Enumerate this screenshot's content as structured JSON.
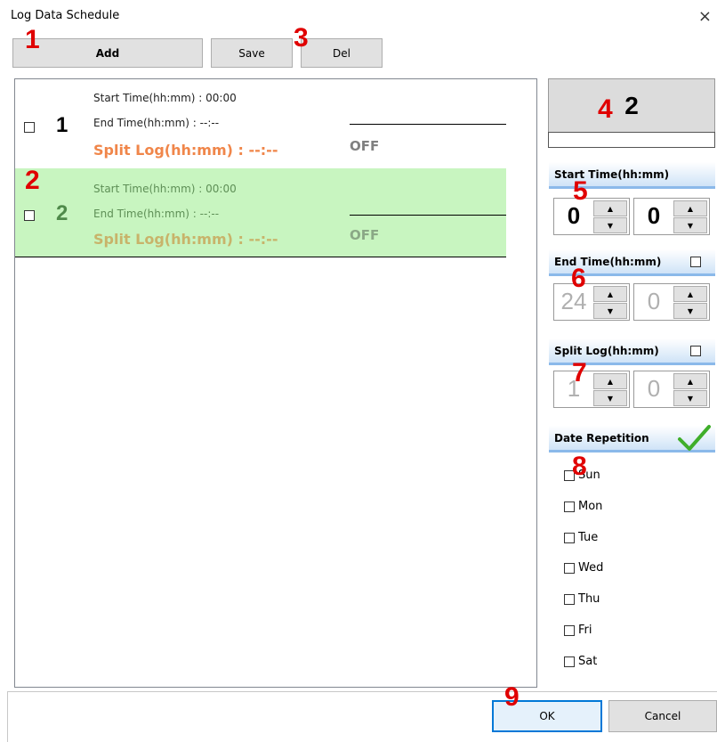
{
  "window": {
    "title": "Log Data Schedule",
    "close_glyph": "×"
  },
  "toolbar": {
    "add_label": "Add",
    "save_label": "Save",
    "del_label": "Del"
  },
  "markers": [
    "1",
    "2",
    "3",
    "4",
    "5",
    "6",
    "7",
    "8",
    "9"
  ],
  "schedule_list": [
    {
      "number": "1",
      "start": "Start Time(hh:mm) : 00:00",
      "end": "End Time(hh:mm) : --:--",
      "split": "Split Log(hh:mm) : --:--",
      "status": "OFF"
    },
    {
      "number": "2",
      "start": "Start Time(hh:mm) : 00:00",
      "end": "End Time(hh:mm) : --:--",
      "split": "Split Log(hh:mm) : --:--",
      "status": "OFF"
    }
  ],
  "selected_number": "2",
  "start_time": {
    "header": "Start Time(hh:mm)",
    "hour": "0",
    "minute": "0"
  },
  "end_time": {
    "header": "End Time(hh:mm)",
    "hour": "24",
    "minute": "0"
  },
  "split_log": {
    "header": "Split Log(hh:mm)",
    "hour": "1",
    "minute": "0"
  },
  "date_repetition": {
    "header": "Date Repetition",
    "days": [
      "Sun",
      "Mon",
      "Tue",
      "Wed",
      "Thu",
      "Fri",
      "Sat"
    ]
  },
  "footer": {
    "ok_label": "OK",
    "cancel_label": "Cancel"
  },
  "spin_glyphs": {
    "up": "▲",
    "down": "▼"
  },
  "colors": {
    "selected_row": "#c8f5c0",
    "split_text": "#f0864a",
    "accent_border": "#0078d7",
    "section_border": "#8bb9ea"
  },
  "icons": {
    "check": "green-checkmark-icon"
  }
}
